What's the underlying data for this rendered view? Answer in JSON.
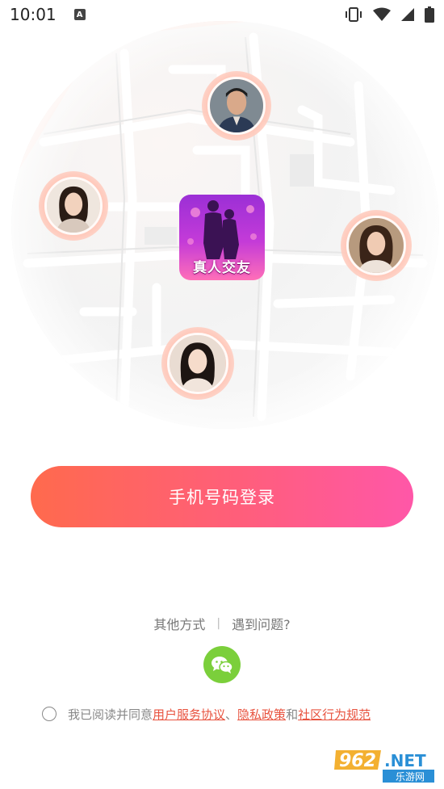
{
  "status_bar": {
    "time": "10:01",
    "notification_icon": "A"
  },
  "app": {
    "logo_text": "真人交友"
  },
  "login": {
    "phone_button_label": "手机号码登录"
  },
  "other": {
    "other_methods_label": "其他方式",
    "separator": "|",
    "problem_label": "遇到问题?",
    "wechat_icon": "wechat-icon"
  },
  "agreement": {
    "prefix": "我已阅读并同意",
    "user_agreement": "用户服务协议",
    "comma": "、",
    "privacy_policy": "隐私政策",
    "and": "和",
    "community_rules": "社区行为规范"
  },
  "watermark": {
    "number": "962",
    "suffix": ".NET",
    "subtitle": "乐游网"
  },
  "colors": {
    "button_start": "#ff6a4d",
    "button_end": "#ff57a8",
    "link": "#e8533f",
    "wechat": "#7bcf3b"
  }
}
